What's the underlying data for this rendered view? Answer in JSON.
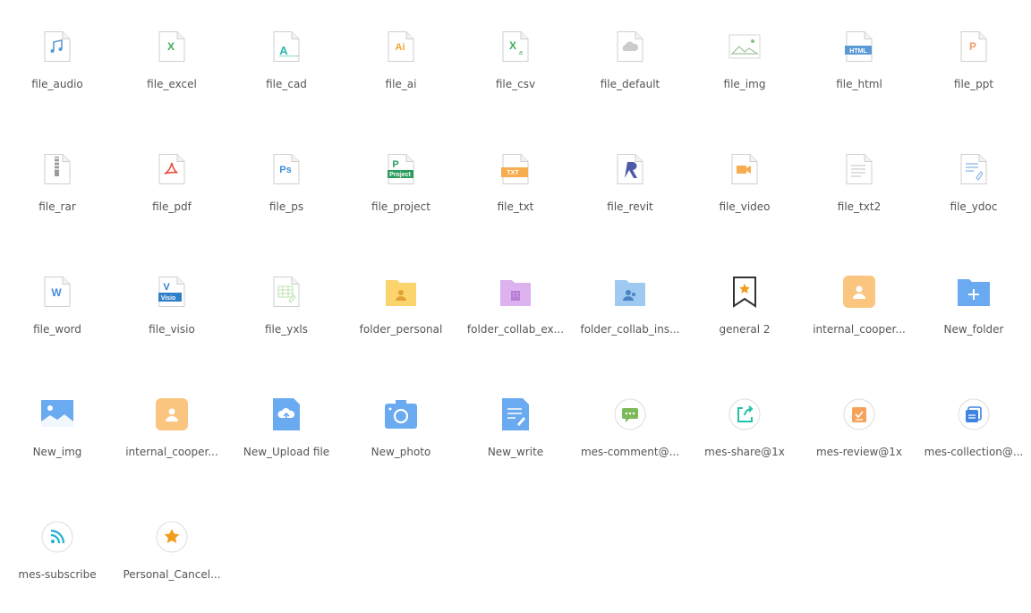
{
  "icons": [
    {
      "label": "file_audio",
      "icon": "file-audio-icon"
    },
    {
      "label": "file_excel",
      "icon": "file-excel-icon"
    },
    {
      "label": "file_cad",
      "icon": "file-cad-icon"
    },
    {
      "label": "file_ai",
      "icon": "file-ai-icon"
    },
    {
      "label": "file_csv",
      "icon": "file-csv-icon"
    },
    {
      "label": "file_default",
      "icon": "file-default-icon"
    },
    {
      "label": "file_img",
      "icon": "file-img-icon"
    },
    {
      "label": "file_html",
      "icon": "file-html-icon"
    },
    {
      "label": "file_ppt",
      "icon": "file-ppt-icon"
    },
    {
      "label": "file_rar",
      "icon": "file-rar-icon"
    },
    {
      "label": "file_pdf",
      "icon": "file-pdf-icon"
    },
    {
      "label": "file_ps",
      "icon": "file-ps-icon"
    },
    {
      "label": "file_project",
      "icon": "file-project-icon"
    },
    {
      "label": "file_txt",
      "icon": "file-txt-icon"
    },
    {
      "label": "file_revit",
      "icon": "file-revit-icon"
    },
    {
      "label": "file_video",
      "icon": "file-video-icon"
    },
    {
      "label": "file_txt2",
      "icon": "file-txt2-icon"
    },
    {
      "label": "file_ydoc",
      "icon": "file-ydoc-icon"
    },
    {
      "label": "file_word",
      "icon": "file-word-icon"
    },
    {
      "label": "file_visio",
      "icon": "file-visio-icon"
    },
    {
      "label": "file_yxls",
      "icon": "file-yxls-icon"
    },
    {
      "label": "folder_personal",
      "icon": "folder-personal-icon"
    },
    {
      "label": "folder_collab_ex...",
      "icon": "folder-collab-external-icon"
    },
    {
      "label": "folder_collab_ins...",
      "icon": "folder-collab-internal-icon"
    },
    {
      "label": "general 2",
      "icon": "bookmark-star-icon"
    },
    {
      "label": "internal_cooper...",
      "icon": "internal-cooperation-icon"
    },
    {
      "label": "New_folder",
      "icon": "new-folder-icon"
    },
    {
      "label": "New_img",
      "icon": "new-image-icon"
    },
    {
      "label": "internal_cooper...",
      "icon": "internal-cooperation-icon"
    },
    {
      "label": "New_Upload file",
      "icon": "upload-file-icon"
    },
    {
      "label": "New_photo",
      "icon": "camera-icon"
    },
    {
      "label": "New_write",
      "icon": "write-icon"
    },
    {
      "label": "mes-comment@...",
      "icon": "comment-icon"
    },
    {
      "label": "mes-share@1x",
      "icon": "share-icon"
    },
    {
      "label": "mes-review@1x",
      "icon": "review-icon"
    },
    {
      "label": "mes-collection@...",
      "icon": "collection-icon"
    },
    {
      "label": "mes-subscribe",
      "icon": "subscribe-icon"
    },
    {
      "label": "Personal_Cancel...",
      "icon": "star-icon"
    }
  ],
  "colors": {
    "label": "#555555",
    "doc_border": "#cfcfcf",
    "excel": "#3fae5b",
    "cad": "#2bb8b0",
    "ai": "#f0a431",
    "html": "#5b9bd5",
    "ppt": "#f39c6b",
    "pdf": "#e84c3d",
    "ps": "#3d8fd8",
    "project": "#2a9d5c",
    "txt": "#f6ad4f",
    "revit": "#4d5aa8",
    "video": "#f6ad4f",
    "word": "#4a8fd8",
    "visio": "#2f7fc9",
    "folder_yellow": "#fbd46f",
    "folder_purple": "#dcb2ee",
    "folder_blue": "#9ec9f0",
    "orange_tile": "#f9c57f",
    "blue_tile": "#6aaaf0",
    "green_msg": "#7dbb5a",
    "teal_msg": "#22c3a6",
    "orange_msg": "#f5a25a",
    "blue_msg": "#3f84e0",
    "subscribe": "#1eaed6",
    "star": "#f29c1b"
  }
}
